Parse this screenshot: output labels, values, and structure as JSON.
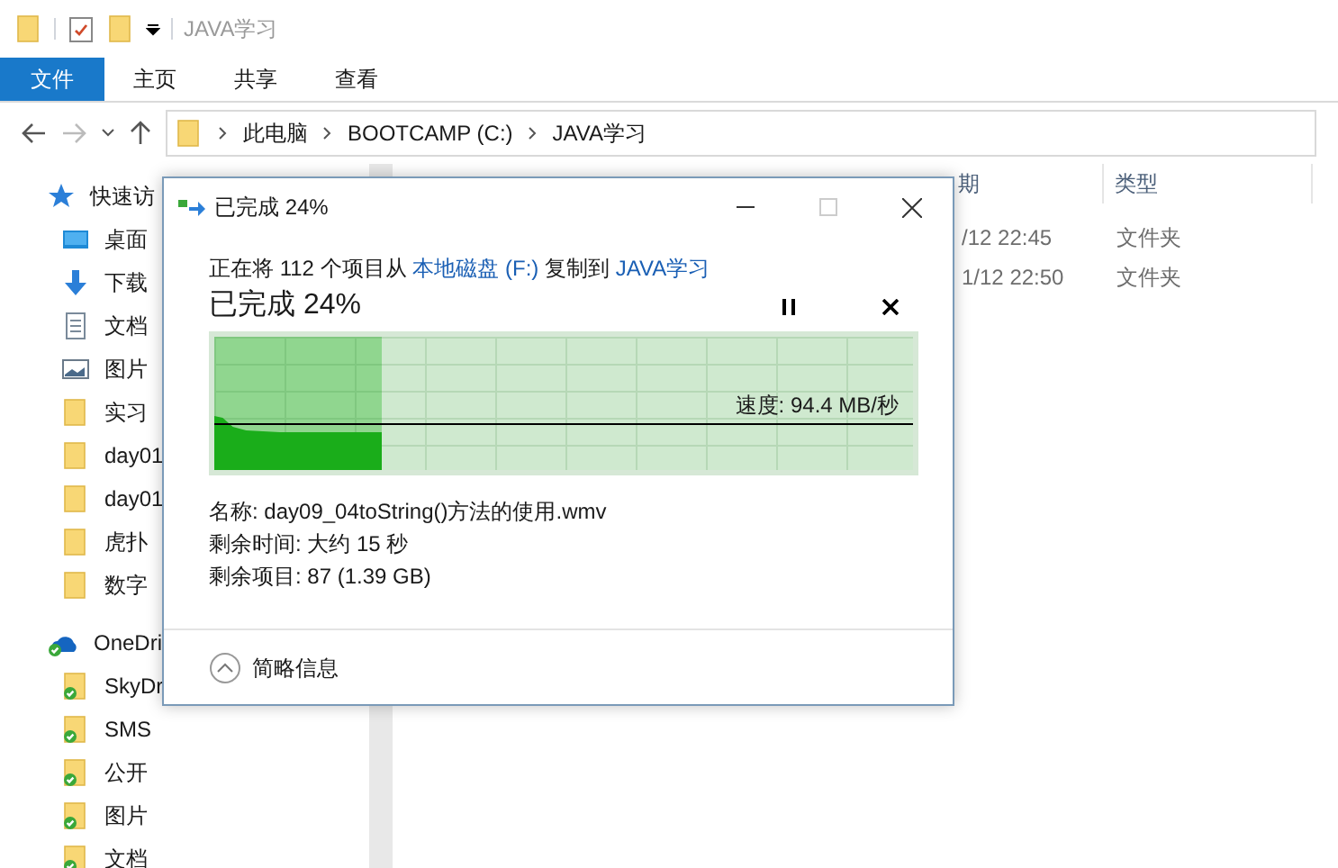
{
  "title_bar": {
    "title": "JAVA学习"
  },
  "ribbon_tabs": [
    {
      "label": "文件",
      "selected": true
    },
    {
      "label": "主页",
      "selected": false
    },
    {
      "label": "共享",
      "selected": false
    },
    {
      "label": "查看",
      "selected": false
    }
  ],
  "address_bar": {
    "path": [
      "此电脑",
      "BOOTCAMP (C:)",
      "JAVA学习"
    ]
  },
  "sidebar": {
    "items": [
      {
        "label": "快速访",
        "kind": "star"
      },
      {
        "label": "桌面",
        "kind": "desktop"
      },
      {
        "label": "下载",
        "kind": "download"
      },
      {
        "label": "文档",
        "kind": "document"
      },
      {
        "label": "图片",
        "kind": "picture"
      },
      {
        "label": "实习",
        "kind": "folder"
      },
      {
        "label": "day01",
        "kind": "folder"
      },
      {
        "label": "day01",
        "kind": "folder"
      },
      {
        "label": "虎扑",
        "kind": "folder"
      },
      {
        "label": "数字",
        "kind": "folder"
      },
      {
        "label": "OneDri",
        "kind": "cloud"
      },
      {
        "label": "SkyDr",
        "kind": "synced"
      },
      {
        "label": "SMS",
        "kind": "synced"
      },
      {
        "label": "公开",
        "kind": "synced"
      },
      {
        "label": "图片",
        "kind": "synced"
      },
      {
        "label": "文档",
        "kind": "synced"
      }
    ]
  },
  "file_list": {
    "columns": [
      "期",
      "类型"
    ],
    "rows": [
      {
        "date": "/12 22:45",
        "type": "文件夹"
      },
      {
        "date": "1/12 22:50",
        "type": "文件夹"
      }
    ]
  },
  "copy_dialog": {
    "title": "已完成 24%",
    "message": {
      "prefix": "正在将 112 个项目从",
      "source": "本地磁盘 (F:)",
      "middle": "复制到",
      "destination": "JAVA学习"
    },
    "heading": "已完成 24%",
    "progress": {
      "level": 0.24,
      "speed": "速度: 94.4 MB/秒"
    },
    "details": [
      "名称: day09_04toString()方法的使用.wmv",
      "剩余时间: 大约 15 秒",
      "剩余项目: 87 (1.39 GB)"
    ],
    "toggle": "简略信息"
  }
}
